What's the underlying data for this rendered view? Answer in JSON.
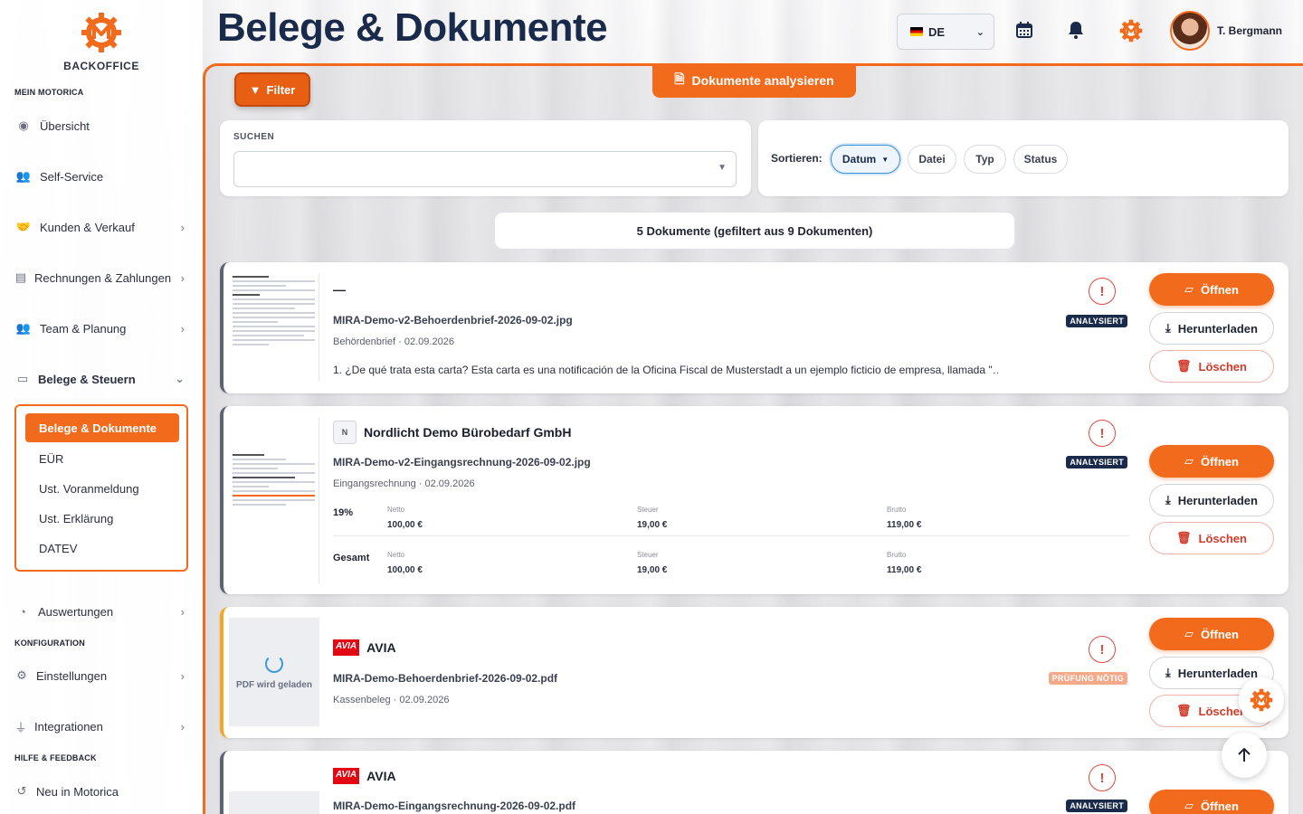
{
  "sidebar": {
    "brand": "BACKOFFICE",
    "sections": {
      "mein": "MEIN MOTORICA",
      "konfig": "KONFIGURATION",
      "hilfe": "HILFE & FEEDBACK"
    },
    "items": [
      {
        "label": "Übersicht",
        "icon": "gauge-icon"
      },
      {
        "label": "Self-Service",
        "icon": "users-gear-icon"
      },
      {
        "label": "Kunden & Verkauf",
        "icon": "handshake-icon"
      },
      {
        "label": "Rechnungen & Zahlungen",
        "icon": "invoice-icon"
      },
      {
        "label": "Team & Planung",
        "icon": "team-icon"
      },
      {
        "label": "Belege & Steuern",
        "icon": "folder-open-icon"
      },
      {
        "label": "Auswertungen",
        "icon": "pie-chart-icon"
      },
      {
        "label": "Einstellungen",
        "icon": "gear-icon"
      },
      {
        "label": "Integrationen",
        "icon": "plug-icon"
      },
      {
        "label": "Neu in Motorica",
        "icon": "history-icon"
      }
    ],
    "sub": [
      "Belege & Dokumente",
      "EÜR",
      "Ust. Voranmeldung",
      "Ust. Erklärung",
      "DATEV"
    ]
  },
  "header": {
    "title": "Belege & Dokumente",
    "lang": "DE",
    "user": "T. Bergmann"
  },
  "toolbar": {
    "filter": "Filter",
    "analyze": "Dokumente analysieren",
    "search_label": "SUCHEN",
    "search_value": "",
    "sort_label": "Sortieren:",
    "sort_options": [
      "Datum",
      "Datei",
      "Typ",
      "Status"
    ],
    "sort_active_arrow": "▼",
    "count": "5 Dokumente (gefiltert aus 9 Dokumenten)"
  },
  "actions": {
    "open": "Öffnen",
    "download": "Herunterladen",
    "delete": "Löschen"
  },
  "documents": [
    {
      "title": "—",
      "file": "MIRA-Demo-v2-Behoerdenbrief-2026-09-02.jpg",
      "meta": "Behördenbrief · 02.09.2026",
      "status": "ANALYSIERT",
      "excerpt": "1. ¿De qué trata esta carta? Esta carta es una notificación de la Oficina Fiscal de Musterstadt a un ejemplo ficticio de empresa, llamada \"…"
    },
    {
      "title": "Nordlicht Demo Bürobedarf GmbH",
      "badge": "N",
      "file": "MIRA-Demo-v2-Eingangsrechnung-2026-09-02.jpg",
      "meta": "Eingangsrechnung · 02.09.2026",
      "status": "ANALYSIERT",
      "tax_headers": {
        "netto": "Netto",
        "steuer": "Steuer",
        "brutto": "Brutto"
      },
      "tax_rows": [
        {
          "label": "19%",
          "netto": "100,00 €",
          "steuer": "19,00 €",
          "brutto": "119,00 €"
        },
        {
          "label": "Gesamt",
          "netto": "100,00 €",
          "steuer": "19,00 €",
          "brutto": "119,00 €"
        }
      ]
    },
    {
      "title": "AVIA",
      "logo": "AVIA",
      "file": "MIRA-Demo-Behoerdenbrief-2026-09-02.pdf",
      "meta": "Kassenbeleg · 02.09.2026",
      "status": "PRÜFUNG NÖTIG",
      "loading": "PDF wird geladen"
    },
    {
      "title": "AVIA",
      "logo": "AVIA",
      "file": "MIRA-Demo-Eingangsrechnung-2026-09-02.pdf",
      "status": "ANALYSIERT"
    }
  ],
  "colors": {
    "accent": "#f26b1d",
    "navy": "#1a2a4a",
    "danger": "#d23a2a",
    "warning": "#f5a623"
  }
}
